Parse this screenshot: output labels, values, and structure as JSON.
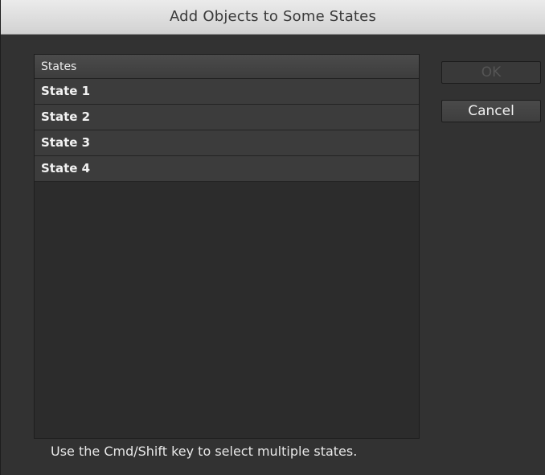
{
  "dialog": {
    "title": "Add Objects to Some States"
  },
  "states_list": {
    "header": "States",
    "items": [
      {
        "label": "State 1"
      },
      {
        "label": "State 2"
      },
      {
        "label": "State 3"
      },
      {
        "label": "State 4"
      }
    ]
  },
  "buttons": {
    "ok_label": "OK",
    "ok_enabled": false,
    "cancel_label": "Cancel"
  },
  "hint_text": "Use the Cmd/Shift key to select multiple states."
}
